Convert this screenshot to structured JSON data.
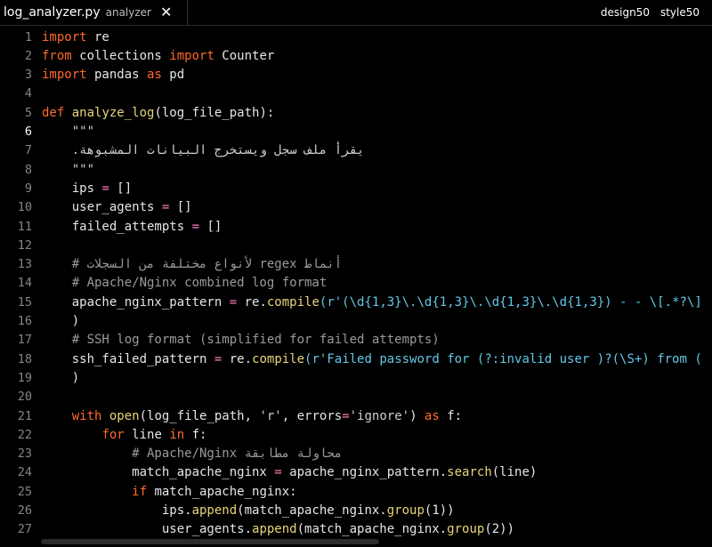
{
  "tab": {
    "filename": "log_analyzer.py",
    "folder": "analyzer",
    "close": "✕"
  },
  "right_tabs": [
    "design50",
    "style50"
  ],
  "code": {
    "active_line": 6,
    "lines": [
      [
        {
          "t": "import",
          "c": "kw"
        },
        {
          "t": " re",
          "c": "txt"
        }
      ],
      [
        {
          "t": "from",
          "c": "kw"
        },
        {
          "t": " collections ",
          "c": "txt"
        },
        {
          "t": "import",
          "c": "kw"
        },
        {
          "t": " Counter",
          "c": "txt"
        }
      ],
      [
        {
          "t": "import",
          "c": "kw"
        },
        {
          "t": " pandas ",
          "c": "txt"
        },
        {
          "t": "as",
          "c": "kw"
        },
        {
          "t": " pd",
          "c": "txt"
        }
      ],
      [],
      [
        {
          "t": "def",
          "c": "kw"
        },
        {
          "t": " ",
          "c": "txt"
        },
        {
          "t": "analyze_log",
          "c": "fn"
        },
        {
          "t": "(log_file_path):",
          "c": "txt"
        }
      ],
      [
        {
          "t": "    \"\"\"",
          "c": "str"
        }
      ],
      [
        {
          "t": "    .يقرأ ملف سجل ويستخرج البيانات المشبوهة",
          "c": "str"
        }
      ],
      [
        {
          "t": "    \"\"\"",
          "c": "str"
        }
      ],
      [
        {
          "t": "    ips ",
          "c": "txt"
        },
        {
          "t": "=",
          "c": "op"
        },
        {
          "t": " []",
          "c": "txt"
        }
      ],
      [
        {
          "t": "    user_agents ",
          "c": "txt"
        },
        {
          "t": "=",
          "c": "op"
        },
        {
          "t": " []",
          "c": "txt"
        }
      ],
      [
        {
          "t": "    failed_attempts ",
          "c": "txt"
        },
        {
          "t": "=",
          "c": "op"
        },
        {
          "t": " []",
          "c": "txt"
        }
      ],
      [],
      [
        {
          "t": "    # لأنواع مختلفة من السجلات regex أنماط",
          "c": "cmt"
        }
      ],
      [
        {
          "t": "    # Apache/Nginx combined log format",
          "c": "cmt"
        }
      ],
      [
        {
          "t": "    apache_nginx_pattern ",
          "c": "txt"
        },
        {
          "t": "=",
          "c": "op"
        },
        {
          "t": " re.",
          "c": "txt"
        },
        {
          "t": "compile",
          "c": "fn"
        },
        {
          "t": "(r'(\\d{1,3}\\.\\d{1,3}\\.\\d{1,3}\\.\\d{1,3}) - - \\[.*?\\]",
          "c": "rgx"
        }
      ],
      [
        {
          "t": "    )",
          "c": "txt"
        }
      ],
      [
        {
          "t": "    # SSH log format (simplified for failed attempts)",
          "c": "cmt"
        }
      ],
      [
        {
          "t": "    ssh_failed_pattern ",
          "c": "txt"
        },
        {
          "t": "=",
          "c": "op"
        },
        {
          "t": " re.",
          "c": "txt"
        },
        {
          "t": "compile",
          "c": "fn"
        },
        {
          "t": "(r'Failed password for (?:invalid user )?(\\S+) from (",
          "c": "rgx"
        }
      ],
      [
        {
          "t": "    )",
          "c": "txt"
        }
      ],
      [],
      [
        {
          "t": "    ",
          "c": "txt"
        },
        {
          "t": "with",
          "c": "kw"
        },
        {
          "t": " ",
          "c": "txt"
        },
        {
          "t": "open",
          "c": "fn"
        },
        {
          "t": "(log_file_path, ",
          "c": "txt"
        },
        {
          "t": "'r'",
          "c": "str"
        },
        {
          "t": ", errors",
          "c": "txt"
        },
        {
          "t": "=",
          "c": "op"
        },
        {
          "t": "'ignore'",
          "c": "str"
        },
        {
          "t": ") ",
          "c": "txt"
        },
        {
          "t": "as",
          "c": "kw"
        },
        {
          "t": " f:",
          "c": "txt"
        }
      ],
      [
        {
          "t": "        ",
          "c": "txt"
        },
        {
          "t": "for",
          "c": "kw"
        },
        {
          "t": " line ",
          "c": "txt"
        },
        {
          "t": "in",
          "c": "kw"
        },
        {
          "t": " f:",
          "c": "txt"
        }
      ],
      [
        {
          "t": "            # Apache/Nginx محاولة مطابقة",
          "c": "cmt"
        }
      ],
      [
        {
          "t": "            match_apache_nginx ",
          "c": "txt"
        },
        {
          "t": "=",
          "c": "op"
        },
        {
          "t": " apache_nginx_pattern.",
          "c": "txt"
        },
        {
          "t": "search",
          "c": "fn"
        },
        {
          "t": "(line)",
          "c": "txt"
        }
      ],
      [
        {
          "t": "            ",
          "c": "txt"
        },
        {
          "t": "if",
          "c": "kw"
        },
        {
          "t": " match_apache_nginx:",
          "c": "txt"
        }
      ],
      [
        {
          "t": "                ips.",
          "c": "txt"
        },
        {
          "t": "append",
          "c": "fn"
        },
        {
          "t": "(match_apache_nginx.",
          "c": "txt"
        },
        {
          "t": "group",
          "c": "fn"
        },
        {
          "t": "(1))",
          "c": "txt"
        }
      ],
      [
        {
          "t": "                user_agents.",
          "c": "txt"
        },
        {
          "t": "append",
          "c": "fn"
        },
        {
          "t": "(match_apache_nginx.",
          "c": "txt"
        },
        {
          "t": "group",
          "c": "fn"
        },
        {
          "t": "(2))",
          "c": "txt"
        }
      ]
    ]
  },
  "colors": {
    "keyword": "#ff6a2b",
    "function": "#e8d57a",
    "operator": "#ff7fc2",
    "string": "#cfcfcf",
    "comment": "#9a9a9a",
    "regex": "#63c7e8",
    "background": "#000000"
  }
}
